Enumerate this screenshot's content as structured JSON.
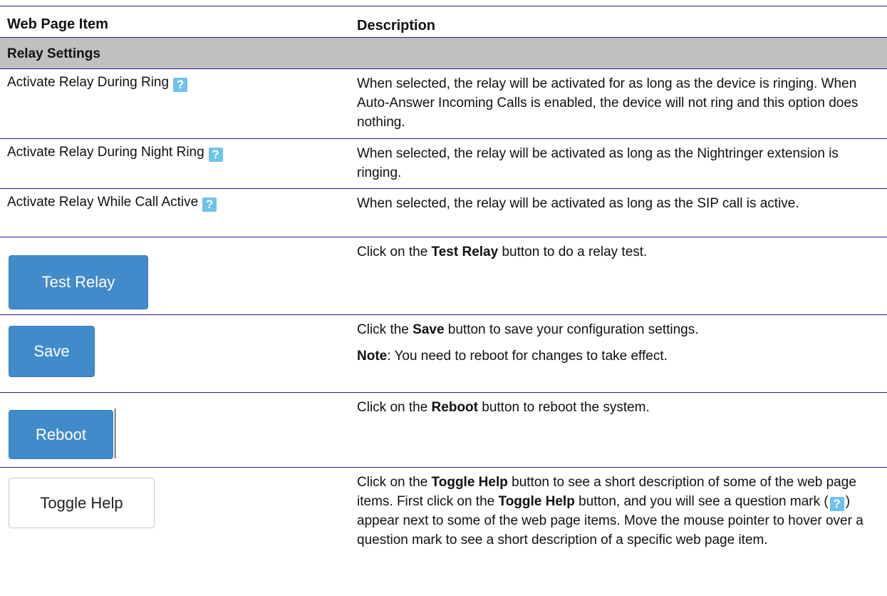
{
  "header": {
    "col1": "Web Page Item",
    "col2": "Description"
  },
  "section_title": "Relay Settings",
  "help_icon_glyph": "?",
  "colors": {
    "rule": "#1f1f8c",
    "section_bg": "#c0c0c0",
    "button_blue": "#428bca",
    "help_icon": "#6fc2ea"
  },
  "rows": {
    "ring": {
      "item": "Activate Relay During Ring",
      "desc": "When selected, the relay will be activated for as long as the device is ringing. When Auto-Answer Incoming Calls is enabled, the device will not ring and this option does nothing."
    },
    "night": {
      "item": "Activate Relay During Night Ring",
      "desc": "When selected, the relay will be activated as long as the Nightringer extension is ringing."
    },
    "call": {
      "item": "Activate Relay While Call Active",
      "desc": "When selected, the relay will be activated as long as the SIP call is active."
    },
    "test": {
      "button": "Test Relay",
      "desc_pre": "Click on the ",
      "desc_bold": "Test Relay",
      "desc_post": " button to do a relay test."
    },
    "save": {
      "button": "Save",
      "desc_pre": "Click the ",
      "desc_bold": "Save",
      "desc_post": " button to save your configuration settings.",
      "note_bold": "Note",
      "note_text": ": You need to reboot for changes to take effect."
    },
    "reboot": {
      "button": "Reboot",
      "desc_pre": "Click on the ",
      "desc_bold": "Reboot",
      "desc_post": " button to reboot the system."
    },
    "toggle": {
      "button": "Toggle Help",
      "p1": "Click on the ",
      "b1": "Toggle Help",
      "p2": " button to see a short description of some of the web page items. First click on the ",
      "b2": "Toggle Help",
      "p3": " button, and you will see a question mark (",
      "p4": ") appear next to some of the web page items. Move the mouse pointer to hover over a question mark to see a short description of a specific web page item."
    }
  }
}
